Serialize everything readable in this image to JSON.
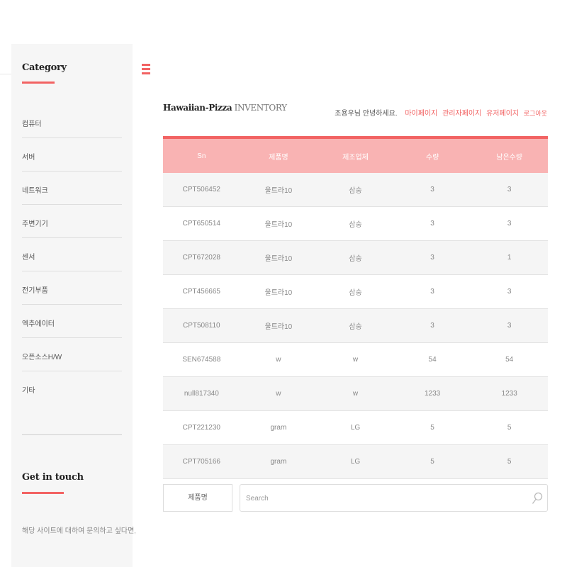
{
  "sidebar": {
    "category_title": "Category",
    "categories": [
      "컴퓨터",
      "서버",
      "네트워크",
      "주변기기",
      "센서",
      "전기부품",
      "엑추에이터",
      "오픈소스H/W",
      "기타"
    ],
    "contact_title": "Get in touch",
    "contact_text": "해당 사이트에 대하여 문의하고 싶다면, 다음 이"
  },
  "header": {
    "brand_name": "Hawaiian-Pizza",
    "brand_suffix": "INVENTORY",
    "greeting": "조용우님 안녕하세요.",
    "links": {
      "mypage": "마이페이지",
      "admin": "관리자페이지",
      "user": "유저페이지",
      "logout": "로그아웃"
    }
  },
  "table": {
    "columns": [
      "Sn",
      "제품명",
      "제조업체",
      "수량",
      "남은수량"
    ],
    "rows": [
      [
        "CPT506452",
        "울트라10",
        "삼숭",
        "3",
        "3"
      ],
      [
        "CPT650514",
        "울트라10",
        "삼숭",
        "3",
        "3"
      ],
      [
        "CPT672028",
        "울트라10",
        "삼숭",
        "3",
        "1"
      ],
      [
        "CPT456665",
        "울트라10",
        "삼숭",
        "3",
        "3"
      ],
      [
        "CPT508110",
        "울트라10",
        "삼숭",
        "3",
        "3"
      ],
      [
        "SEN674588",
        "w",
        "w",
        "54",
        "54"
      ],
      [
        "null817340",
        "w",
        "w",
        "1233",
        "1233"
      ],
      [
        "CPT221230",
        "gram",
        "LG",
        "5",
        "5"
      ],
      [
        "CPT705166",
        "gram",
        "LG",
        "5",
        "5"
      ]
    ]
  },
  "search": {
    "filter_label": "제품명",
    "placeholder": "Search",
    "value": ""
  },
  "colors": {
    "accent": "#f26363",
    "table_header": "#f9b3b3",
    "sidebar_bg": "#f6f6f6"
  }
}
